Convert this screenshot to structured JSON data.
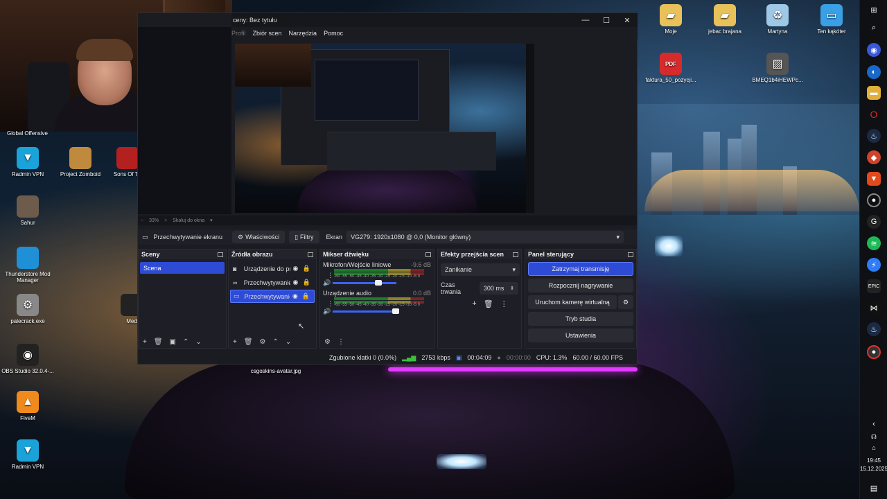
{
  "desktop": {
    "icons_left": [
      {
        "label": "Radmin VPN",
        "icon": "radmin-icon",
        "color": "#1aa3d9"
      },
      {
        "label": "Project Zomboid",
        "icon": "zomboid-icon",
        "color": "#c08a3e"
      },
      {
        "label": "Sons Of Th",
        "icon": "sons-icon",
        "color": "#b32020"
      },
      {
        "label": "Sahur",
        "icon": "sahur-icon",
        "color": "#6d5b4c"
      },
      {
        "label": "Thunderstore Mod Manager",
        "icon": "thunderstore-icon",
        "color": "#1f8fd6"
      },
      {
        "label": "Med",
        "icon": "med-icon",
        "color": "#222"
      },
      {
        "label": "palecrack.exe",
        "icon": "gear-icon",
        "color": "#888"
      },
      {
        "label": "OBS Studio 32.0.4-...",
        "icon": "obs-icon",
        "color": "#222"
      },
      {
        "label": "csgoskins-avatar.jpg",
        "icon": "image-icon",
        "color": "#444"
      },
      {
        "label": "FiveM",
        "icon": "fivem-icon",
        "color": "#f08a1c"
      },
      {
        "label": "Radmin VPN",
        "icon": "radmin-icon",
        "color": "#1aa3d9"
      }
    ],
    "global_offensive": "Global Offensive",
    "icons_right": [
      {
        "label": "Moje",
        "icon": "folder-icon",
        "color": "#e8c15a"
      },
      {
        "label": "jebac brajana",
        "icon": "folder-icon",
        "color": "#e8c15a"
      },
      {
        "label": "Martyna",
        "icon": "recycle-bin-icon",
        "color": "#9fc7e6"
      },
      {
        "label": "Ten kąkóter",
        "icon": "computer-icon",
        "color": "#3aa0e6"
      },
      {
        "label": "faktura_50_pozycji...",
        "icon": "pdf-icon",
        "color": "#d72b2b"
      },
      {
        "label": "BMEQ1b4iHEWPc...",
        "icon": "image-icon",
        "color": "#555"
      }
    ]
  },
  "taskbar": {
    "time": "19:45",
    "date": "15.12.2025"
  },
  "obs": {
    "title": "ceny: Bez tytułu",
    "menu": [
      "Profil",
      "Zbiór scen",
      "Narzędzia",
      "Pomoc"
    ],
    "zoom": {
      "level": "33%",
      "fit_label": "Skaluj do okna"
    },
    "source_toolbar": {
      "source_name": "Przechwytywanie ekranu",
      "properties": "Właściwości",
      "filters": "Filtry",
      "screen_label": "Ekran",
      "screen_value": "VG279: 1920x1080 @ 0,0 (Monitor główny)"
    },
    "scenes": {
      "title": "Sceny",
      "items": [
        "Scena"
      ]
    },
    "sources": {
      "title": "Źródła obrazu",
      "items": [
        {
          "name": "Urządzenie do pr",
          "icon": "camera-icon"
        },
        {
          "name": "Przechwytywanie",
          "icon": "link-icon"
        },
        {
          "name": "Przechwytywanie",
          "icon": "monitor-icon"
        }
      ]
    },
    "mixer": {
      "title": "Mikser dźwięku",
      "channels": [
        {
          "name": "Mikrofon/Wejście liniowe",
          "db": "-9.6 dB",
          "level": 0.73
        },
        {
          "name": "Urządzenie audio",
          "db": "0.0 dB",
          "level": 1.0
        }
      ],
      "ticks": "-60 -55 -50 -45 -40 -35 -30 -25 -20 -15 -10 -5 0"
    },
    "transitions": {
      "title": "Efekty przejścia scen",
      "selected": "Zanikanie",
      "duration_label": "Czas trwania",
      "duration_value": "300 ms"
    },
    "controls": {
      "title": "Panel sterujący",
      "buttons": [
        "Zatrzymaj transmisję",
        "Rozpocznij nagrywanie",
        "Uruchom kamerę wirtualną",
        "Tryb studia",
        "Ustawienia"
      ]
    },
    "status": {
      "dropped": "Zgubione klatki 0 (0.0%)",
      "bitrate": "2753 kbps",
      "stream_time": "00:04:09",
      "rec_time": "00:00:00",
      "cpu": "CPU: 1.3%",
      "fps": "60.00 / 60.00 FPS"
    }
  }
}
